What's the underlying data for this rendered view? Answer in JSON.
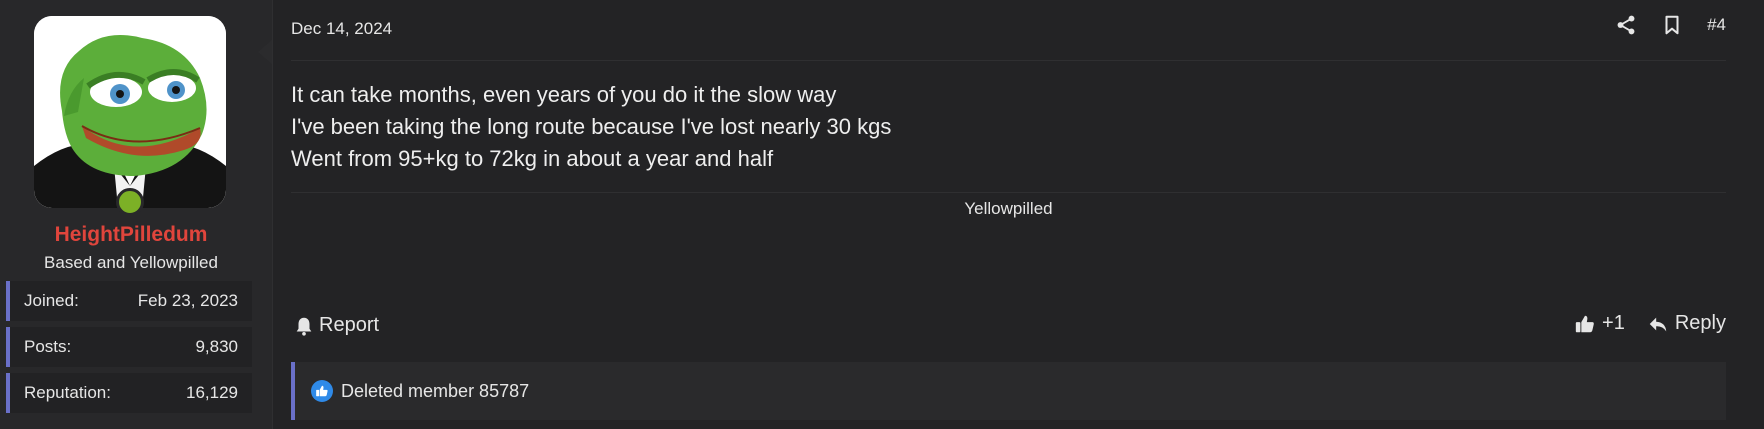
{
  "user": {
    "name": "HeightPilledum",
    "title": "Based and Yellowpilled",
    "stats": [
      {
        "label": "Joined:",
        "value": "Feb 23, 2023"
      },
      {
        "label": "Posts:",
        "value": "9,830"
      },
      {
        "label": "Reputation:",
        "value": "16,129"
      }
    ],
    "online_color": "#7cb026",
    "name_color": "#e0453c"
  },
  "post": {
    "date": "Dec 14, 2024",
    "number": "#4",
    "lines": [
      "It can take months, even years of you do it the slow way",
      "I've been taking the long route because I've lost nearly 30 kgs",
      "Went from 95+kg to 72kg in about a year and half"
    ],
    "signature": "Yellowpilled"
  },
  "icons": {
    "share": "share-icon",
    "bookmark": "bookmark-icon",
    "report": "bell-icon",
    "like": "thumbs-up-icon",
    "reply": "reply-icon"
  },
  "footer": {
    "report_label": "Report",
    "like_label": "+1",
    "reply_label": "Reply"
  },
  "reactions": {
    "text": "Deleted member 85787",
    "badge_color": "#2f8ae8"
  },
  "accent_color": "#6a70c9"
}
